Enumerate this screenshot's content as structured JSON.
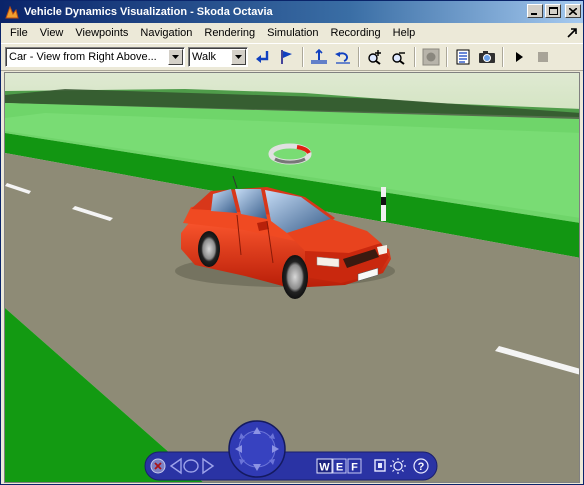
{
  "window": {
    "title": "Vehicle Dynamics Visualization - Skoda Octavia"
  },
  "menu": {
    "items": [
      "File",
      "View",
      "Viewpoints",
      "Navigation",
      "Rendering",
      "Simulation",
      "Recording",
      "Help"
    ]
  },
  "toolbar": {
    "viewpoint_select": "Car - View from Right Above...",
    "navigation_select": "Walk"
  },
  "navpanel": {
    "walk_label": "W",
    "examine_label": "E",
    "fly_label": "F",
    "help_label": "?"
  },
  "colors": {
    "sky": "#d9e6c9",
    "far_grass": "#5ecb5e",
    "near_grass": "#169b16",
    "road": "#8f8d79",
    "car_body": "#e83c1a",
    "nav_panel": "#2c35a6"
  },
  "icons": [
    "app-icon",
    "minimize-icon",
    "maximize-icon",
    "close-icon",
    "dock-icon",
    "return-icon",
    "flag-icon",
    "straighten-icon",
    "undo-move-icon",
    "zoom-in-icon",
    "zoom-out-icon",
    "record-icon",
    "properties-icon",
    "camera-icon",
    "play-icon",
    "stop-icon"
  ]
}
